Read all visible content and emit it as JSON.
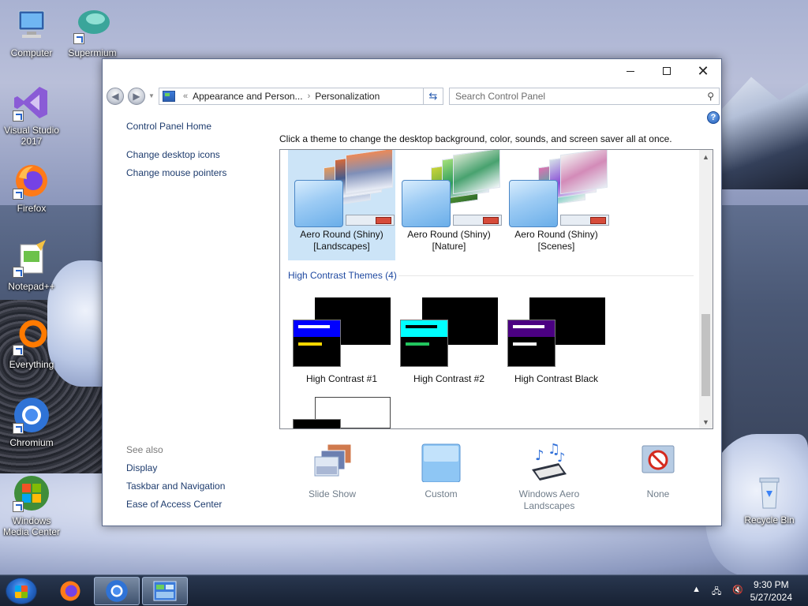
{
  "desktop": {
    "icons": [
      {
        "label": "Computer"
      },
      {
        "label": "Supermium"
      },
      {
        "label": "Visual Studio 2017"
      },
      {
        "label": "Firefox"
      },
      {
        "label": "Notepad++"
      },
      {
        "label": "Everything"
      },
      {
        "label": "Chromium"
      },
      {
        "label": "Windows Media Center"
      },
      {
        "label": "Recycle Bin"
      }
    ]
  },
  "window": {
    "breadcrumb": [
      "Appearance and Person...",
      "Personalization"
    ],
    "breadcrumb_overflow": "«",
    "search_placeholder": "Search Control Panel",
    "help": "?"
  },
  "leftpane": {
    "home": "Control Panel Home",
    "links": [
      "Change desktop icons",
      "Change mouse pointers"
    ]
  },
  "see_also": {
    "header": "See also",
    "links": [
      "Display",
      "Taskbar and Navigation",
      "Ease of Access Center"
    ]
  },
  "main": {
    "instruction": "Click a theme to change the desktop background, color, sounds, and screen saver all at once.",
    "aero_themes": [
      {
        "line1": "Aero Round (Shiny)",
        "line2": "[Landscapes]",
        "selected": true
      },
      {
        "line1": "Aero Round (Shiny)",
        "line2": "[Nature]",
        "selected": false
      },
      {
        "line1": "Aero Round (Shiny)",
        "line2": "[Scenes]",
        "selected": false
      }
    ],
    "hc_section_title": "High Contrast Themes (4)",
    "hc_themes": [
      {
        "label": "High Contrast #1",
        "bar_color": "#0000ff",
        "accent_color": "#ffd700"
      },
      {
        "label": "High Contrast #2",
        "bar_color": "#00ffff",
        "accent_color": "#22c55e"
      },
      {
        "label": "High Contrast Black",
        "bar_color": "#4b0082",
        "accent_color": "#ffffff"
      }
    ]
  },
  "bottom_bar": [
    {
      "label": "Slide Show",
      "icon": "slideshow-icon"
    },
    {
      "label": "Custom",
      "icon": "custom-color-icon"
    },
    {
      "label": "Windows Aero Landscapes",
      "icon": "sounds-icon"
    },
    {
      "label": "None",
      "icon": "screensaver-none-icon"
    }
  ],
  "taskbar": {
    "time": "9:30 PM",
    "date": "5/27/2024"
  }
}
